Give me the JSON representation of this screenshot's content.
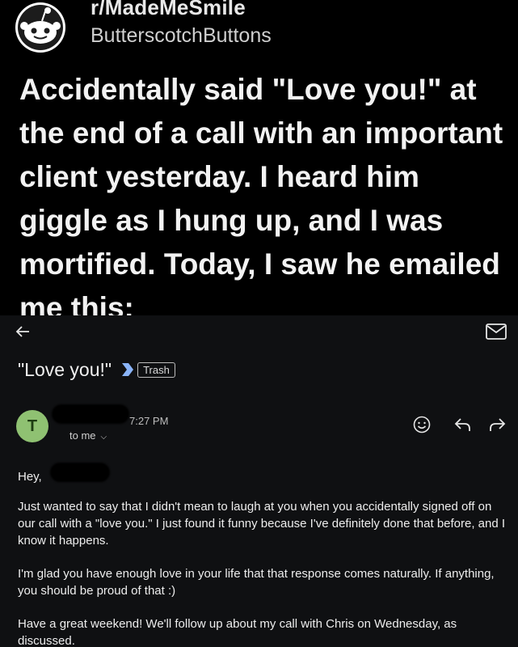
{
  "post": {
    "subreddit": "r/MadeMeSmile",
    "username": "ButterscotchButtons",
    "title": "Accidentally said \"Love you!\" at the end of a call with an important client yesterday. I heard him giggle as I hung up, and I was mortified. Today, I saw he emailed me this:"
  },
  "email": {
    "subject": "\"Love you!\"",
    "label": "Trash",
    "sender_initial": "T",
    "time": "7:27 PM",
    "recipient": "to me",
    "greeting": "Hey,",
    "paragraphs": [
      "Just wanted to say that I didn't mean to laugh at you when you accidentally signed off on our call with a \"love you.\" I just found it funny because I've definitely done that before, and I know it happens.",
      "I'm glad you have enough love in your life that that response comes naturally. If anything, you should be proud of that :)",
      "Have a great weekend! We'll follow up about my call with Chris on Wednesday, as discussed."
    ],
    "avatar_color": "#8fc172",
    "background_color": "#0f1012"
  },
  "icons": [
    "snoo-avatar-icon",
    "back-arrow-icon",
    "mail-icon",
    "label-arrow-icon",
    "emoji-reaction-icon",
    "reply-icon",
    "forward-icon",
    "chevron-down-icon"
  ]
}
